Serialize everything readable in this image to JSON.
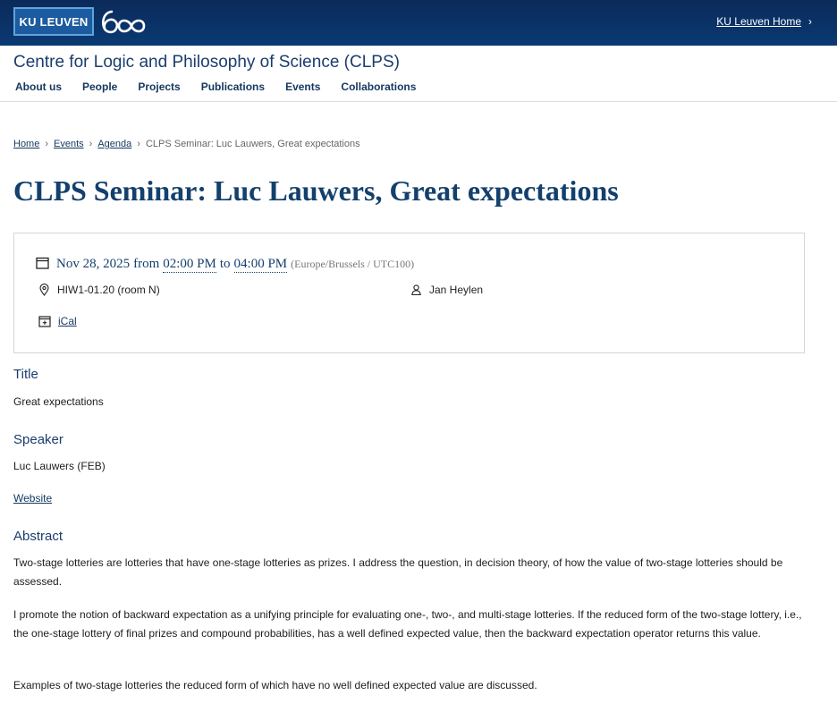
{
  "brand": {
    "logo_text": "KU LEUVEN",
    "anniversary_mark": "600",
    "home_link": "KU Leuven Home",
    "home_chevron": "›"
  },
  "site": {
    "title": "Centre for Logic and Philosophy of Science (CLPS)",
    "nav": [
      "About us",
      "People",
      "Projects",
      "Publications",
      "Events",
      "Collaborations"
    ]
  },
  "breadcrumb": {
    "items": [
      "Home",
      "Events",
      "Agenda"
    ],
    "separator": "›",
    "current": "CLPS Seminar: Luc Lauwers, Great expectations"
  },
  "event": {
    "title": "CLPS Seminar: Luc Lauwers, Great expectations",
    "date": "Nov 28, 2025",
    "from_label": "from",
    "start": "02:00 PM",
    "to_label": "to",
    "end": "04:00 PM",
    "timezone": "(Europe/Brussels / UTC100)",
    "location": "HIW1-01.20 (room N)",
    "contact": "Jan Heylen",
    "ical": "iCal",
    "icons": {
      "calendar": "calendar-icon",
      "location": "map-pin-icon",
      "person": "person-icon",
      "add_calendar": "calendar-plus-icon"
    }
  },
  "sections": {
    "title_heading": "Title",
    "title_value": "Great expectations",
    "speaker_heading": "Speaker",
    "speaker_value": "Luc Lauwers (FEB)",
    "website_link": "Website",
    "abstract_heading": "Abstract",
    "abstract_paragraphs": [
      "Two-stage lotteries are lotteries that have one-stage lotteries as prizes. I address the question, in decision theory, of how the value of two-stage lotteries should be assessed.",
      "I promote the notion of backward expectation as a unifying principle for evaluating one-, two-, and multi-stage lotteries. If the reduced form of the two-stage lottery, i.e., the one-stage lottery of final prizes and compound probabilities, has a well defined expected value, then the backward expectation operator returns this value.",
      "Examples of two-stage lotteries the reduced form of which have no well defined expected value are discussed."
    ]
  },
  "colors": {
    "banner": "#0b2a5a",
    "accent": "#13406d",
    "link": "#14375f"
  }
}
